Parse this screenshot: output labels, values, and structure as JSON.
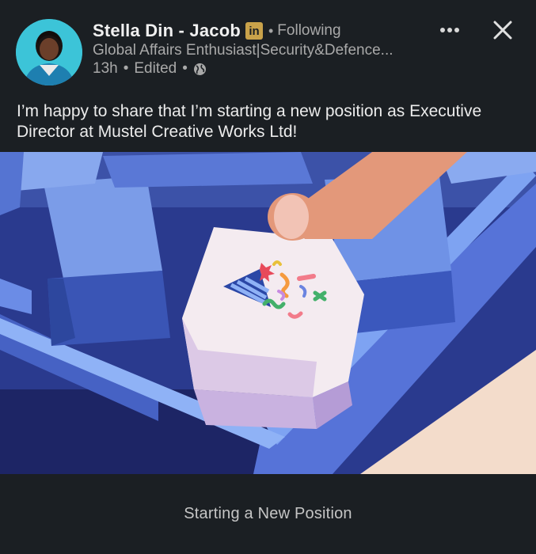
{
  "author": {
    "name": "Stella Din - Jacob",
    "badge": "in",
    "follow_status": "Following",
    "headline": "Global Affairs Enthusiast|Security&Defence...",
    "time": "13h",
    "edited": "Edited",
    "visibility_icon": "globe-icon"
  },
  "actions": {
    "more_icon": "more-horizontal-icon",
    "close_icon": "close-icon"
  },
  "post": {
    "text": "I’m happy to share that I’m starting a new position as Executive Director at Mustel Creative Works Ltd!",
    "image_subject": "keyboard-key-pressed-with-confetti"
  },
  "caption": {
    "text": "Starting a New Position"
  },
  "colors": {
    "background": "#1b1f23",
    "image_blue": "#4a68c8",
    "accent_badge": "#c9a24a"
  }
}
